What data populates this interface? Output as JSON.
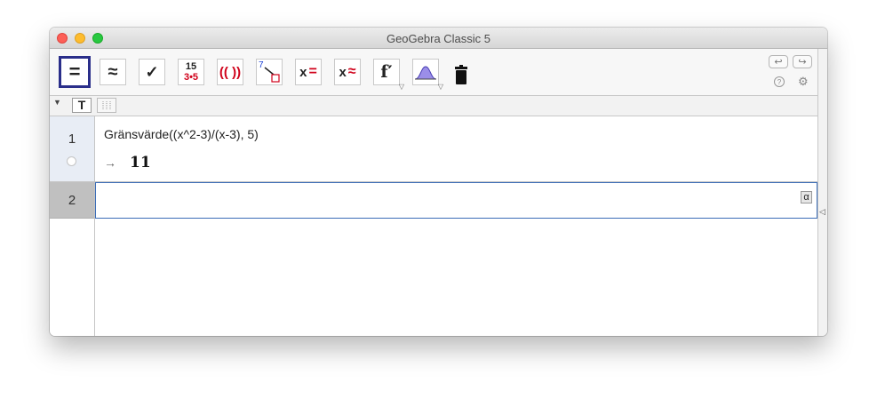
{
  "window": {
    "title": "GeoGebra Classic 5"
  },
  "toolbar": {
    "tools": [
      {
        "name": "evaluate-tool",
        "glyph": "="
      },
      {
        "name": "numeric-tool",
        "glyph": "≈"
      },
      {
        "name": "keep-input-tool",
        "glyph": "✓"
      },
      {
        "name": "factor-number-tool",
        "glyph_top": "15",
        "glyph_bottom": "3•5"
      },
      {
        "name": "expand-tool",
        "glyph": "(( ))"
      },
      {
        "name": "substitute-tool",
        "glyph": "7"
      },
      {
        "name": "solve-tool",
        "glyph_x": "x",
        "glyph_op": "="
      },
      {
        "name": "solve-numerically-tool",
        "glyph_x": "x",
        "glyph_op": "≈"
      },
      {
        "name": "derivative-tool",
        "glyph": "f′"
      },
      {
        "name": "probability-tool",
        "glyph": ""
      },
      {
        "name": "delete-tool",
        "glyph": ""
      }
    ],
    "undo": "↩",
    "redo": "↪",
    "help": "?",
    "settings": "⚙"
  },
  "subbar": {
    "text_tool": "T"
  },
  "rows": [
    {
      "number": "1",
      "input": "Gränsvärde((x^2-3)/(x-3), 5)",
      "arrow": "→",
      "output": "11"
    },
    {
      "number": "2",
      "input": "",
      "keyboard": "α"
    }
  ]
}
